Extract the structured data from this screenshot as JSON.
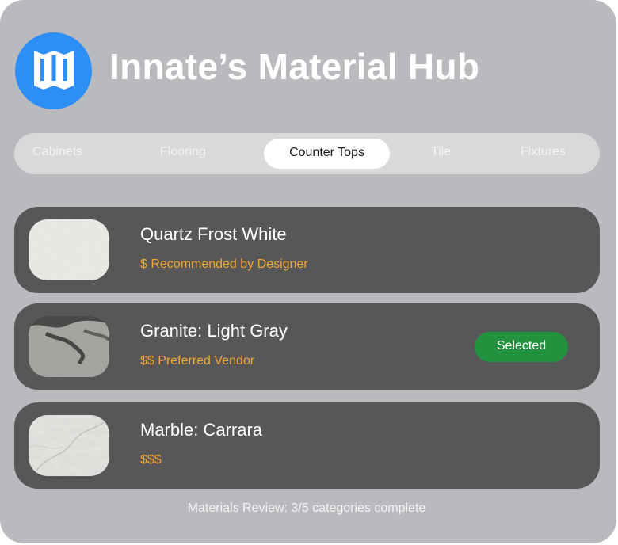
{
  "header": {
    "title": "Innate’s Material Hub",
    "logo_icon": "book-open-icon",
    "logo_color": "#2d8ef5"
  },
  "tabs": [
    {
      "label": "Cabinets",
      "active": false
    },
    {
      "label": "Flooring",
      "active": false
    },
    {
      "label": "Counter Tops",
      "active": true
    },
    {
      "label": "Tile",
      "active": false
    },
    {
      "label": "Fixtures",
      "active": false
    }
  ],
  "materials": [
    {
      "name": "Quartz Frost White",
      "price": "$ Recommended by Designer",
      "swatch": "quartz-swatch-image"
    },
    {
      "name": "Granite: Light Gray",
      "price": "$$ Preferred Vendor",
      "swatch": "granite-swatch-image",
      "status": "Selected"
    },
    {
      "name": "Marble: Carrara",
      "price": "$$$",
      "swatch": "marble-swatch-image"
    }
  ],
  "footer": {
    "status": "Materials Review: 3/5 categories complete"
  },
  "colors": {
    "background": "#b9babd",
    "row_background": "#575757",
    "price_accent": "#f2a530",
    "selected_green": "#22923f"
  }
}
